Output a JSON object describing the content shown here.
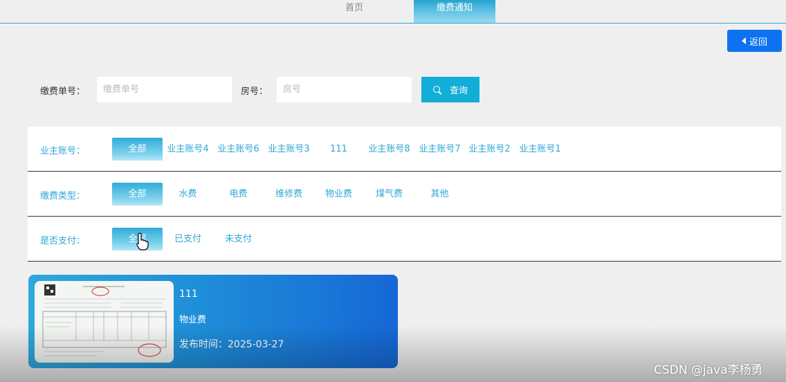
{
  "nav": {
    "home": "首页",
    "notice": "缴费通知"
  },
  "back_button": "返回",
  "search": {
    "bill_no_label": "缴费单号：",
    "bill_no_placeholder": "缴费单号",
    "room_label": "房号：",
    "room_placeholder": "房号",
    "button": "查询"
  },
  "filters": {
    "owner": {
      "label": "业主账号：",
      "options": [
        "全部",
        "业主账号4",
        "业主账号6",
        "业主账号3",
        "111",
        "业主账号8",
        "业主账号7",
        "业主账号2",
        "业主账号1"
      ],
      "selected": "全部"
    },
    "fee_type": {
      "label": "缴费类型：",
      "options": [
        "全部",
        "水费",
        "电费",
        "维修费",
        "物业费",
        "煤气费",
        "其他"
      ],
      "selected": "全部"
    },
    "paid": {
      "label": "是否支付：",
      "options": [
        "全部",
        "已支付",
        "未支付"
      ],
      "selected": "全部"
    }
  },
  "card": {
    "title": "111",
    "type": "物业费",
    "date": "发布时间：2025-03-27"
  },
  "watermark": "CSDN @java李杨勇",
  "colors": {
    "accent": "#2ea7d6",
    "back_button": "#0e72f0",
    "search_button": "#11aed8"
  }
}
